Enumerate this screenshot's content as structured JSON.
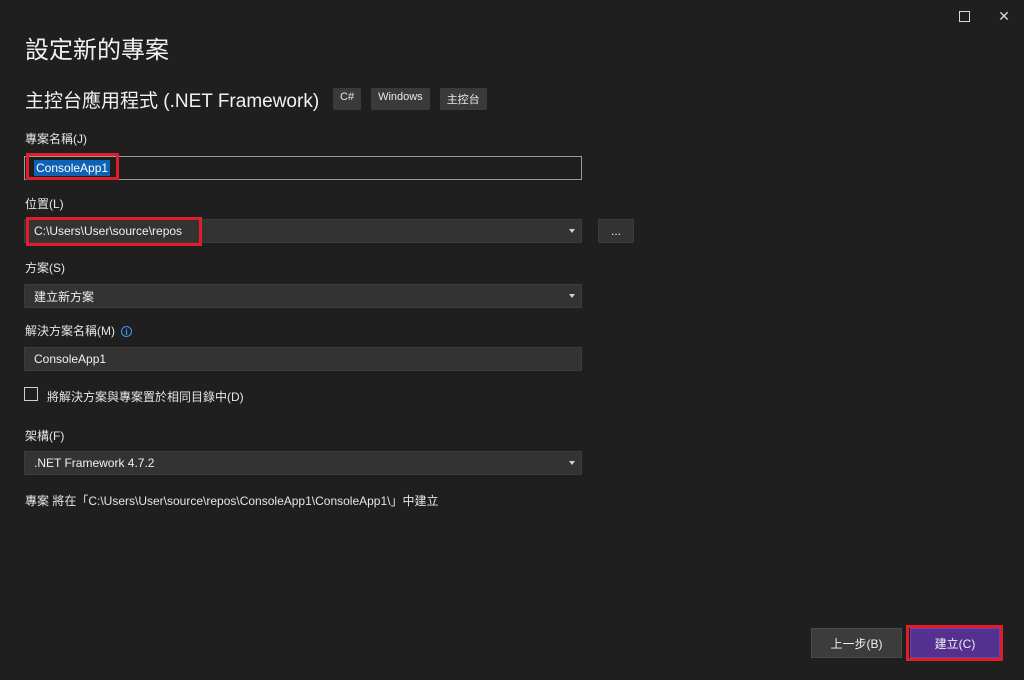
{
  "window": {
    "maximize_icon": "maximize-icon",
    "close_icon": "close-icon",
    "close_glyph": "✕"
  },
  "header": {
    "title": "設定新的專案",
    "template_name": "主控台應用程式 (.NET Framework)",
    "tags": [
      "C#",
      "Windows",
      "主控台"
    ]
  },
  "project_name": {
    "label": "專案名稱(J)",
    "value": "ConsoleApp1"
  },
  "location": {
    "label": "位置(L)",
    "value": "C:\\Users\\User\\source\\repos",
    "browse_label": "..."
  },
  "solution": {
    "label": "方案(S)",
    "value": "建立新方案"
  },
  "solution_name": {
    "label": "解決方案名稱(M)",
    "value": "ConsoleApp1",
    "info_glyph": "i"
  },
  "same_directory": {
    "label": "將解決方案與專案置於相同目錄中(D)",
    "checked": false
  },
  "framework": {
    "label": "架構(F)",
    "value": ".NET Framework 4.7.2"
  },
  "summary": "專案 將在「C:\\Users\\User\\source\\repos\\ConsoleApp1\\ConsoleApp1\\」中建立",
  "buttons": {
    "back": "上一步(B)",
    "create": "建立(C)"
  },
  "colors": {
    "background": "#1f1f1f",
    "accent": "#54308f",
    "highlight": "#e01d2a",
    "selection": "#0e62b5"
  }
}
